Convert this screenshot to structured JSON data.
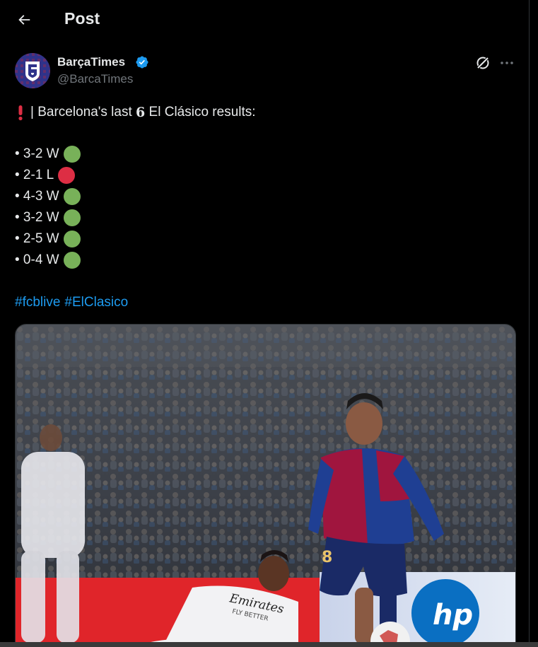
{
  "header": {
    "title": "Post",
    "back_icon": "arrow-left-icon"
  },
  "author": {
    "name": "BarçaTimes",
    "handle": "@BarcaTimes",
    "verified": true,
    "verified_color": "#1d9bf0"
  },
  "actions": {
    "grok_icon": "grok-icon",
    "more_icon": "more-horizontal-icon"
  },
  "tweet": {
    "intro_prefix": "| Barcelona's last ",
    "intro_number": "6",
    "intro_suffix": " El Clásico results:",
    "results": [
      {
        "text": "• 3-2 W",
        "outcome": "win",
        "color": "#78b159"
      },
      {
        "text": "• 2-1 L",
        "outcome": "loss",
        "color": "#dd2e44"
      },
      {
        "text": "• 4-3 W",
        "outcome": "win",
        "color": "#78b159"
      },
      {
        "text": "• 3-2 W",
        "outcome": "win",
        "color": "#78b159"
      },
      {
        "text": "• 2-5 W",
        "outcome": "win",
        "color": "#78b159"
      },
      {
        "text": "• 0-4 W",
        "outcome": "win",
        "color": "#78b159"
      }
    ],
    "hashtags": [
      "#fcblive",
      "#ElClasico"
    ]
  },
  "media": {
    "jersey_text_left": "Emirates",
    "jersey_text_left_sub": "FLY BETTER",
    "player_number": "8"
  },
  "colors": {
    "background": "#000000",
    "text": "#e7e9ea",
    "secondary": "#71767b",
    "link": "#1d9bf0",
    "border": "#2f3336"
  }
}
